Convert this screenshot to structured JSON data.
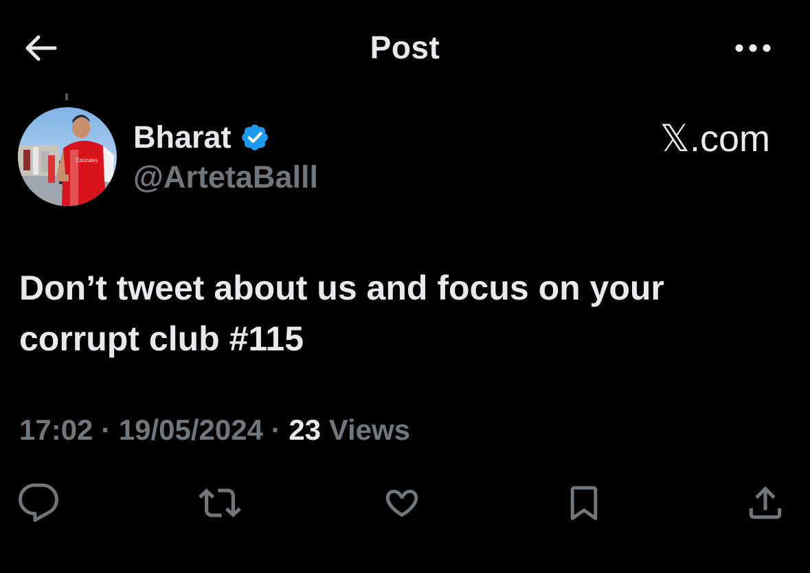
{
  "header": {
    "title": "Post",
    "back_icon": "arrow-left-icon",
    "more_icon": "more-horizontal-icon"
  },
  "author": {
    "name": "Bharat",
    "handle": "@ArtetaBalll",
    "verified": true,
    "verified_color": "#1d9bf0",
    "avatar_icon": "avatar-photo"
  },
  "source": "𝕏.com",
  "post": {
    "text": "Don’t tweet about us and focus on your\ncorrupt club #115"
  },
  "meta": {
    "time": "17:02",
    "separator": "·",
    "date": "19/05/2024",
    "views_count": "23",
    "views_label": "Views"
  },
  "actions": [
    {
      "name": "reply",
      "icon": "reply-icon"
    },
    {
      "name": "repost",
      "icon": "repost-icon"
    },
    {
      "name": "like",
      "icon": "heart-icon"
    },
    {
      "name": "bookmark",
      "icon": "bookmark-icon"
    },
    {
      "name": "share",
      "icon": "share-icon"
    }
  ],
  "colors": {
    "background": "#000000",
    "primary_text": "#e7e9ea",
    "secondary_text": "#71767b",
    "accent": "#1d9bf0"
  }
}
